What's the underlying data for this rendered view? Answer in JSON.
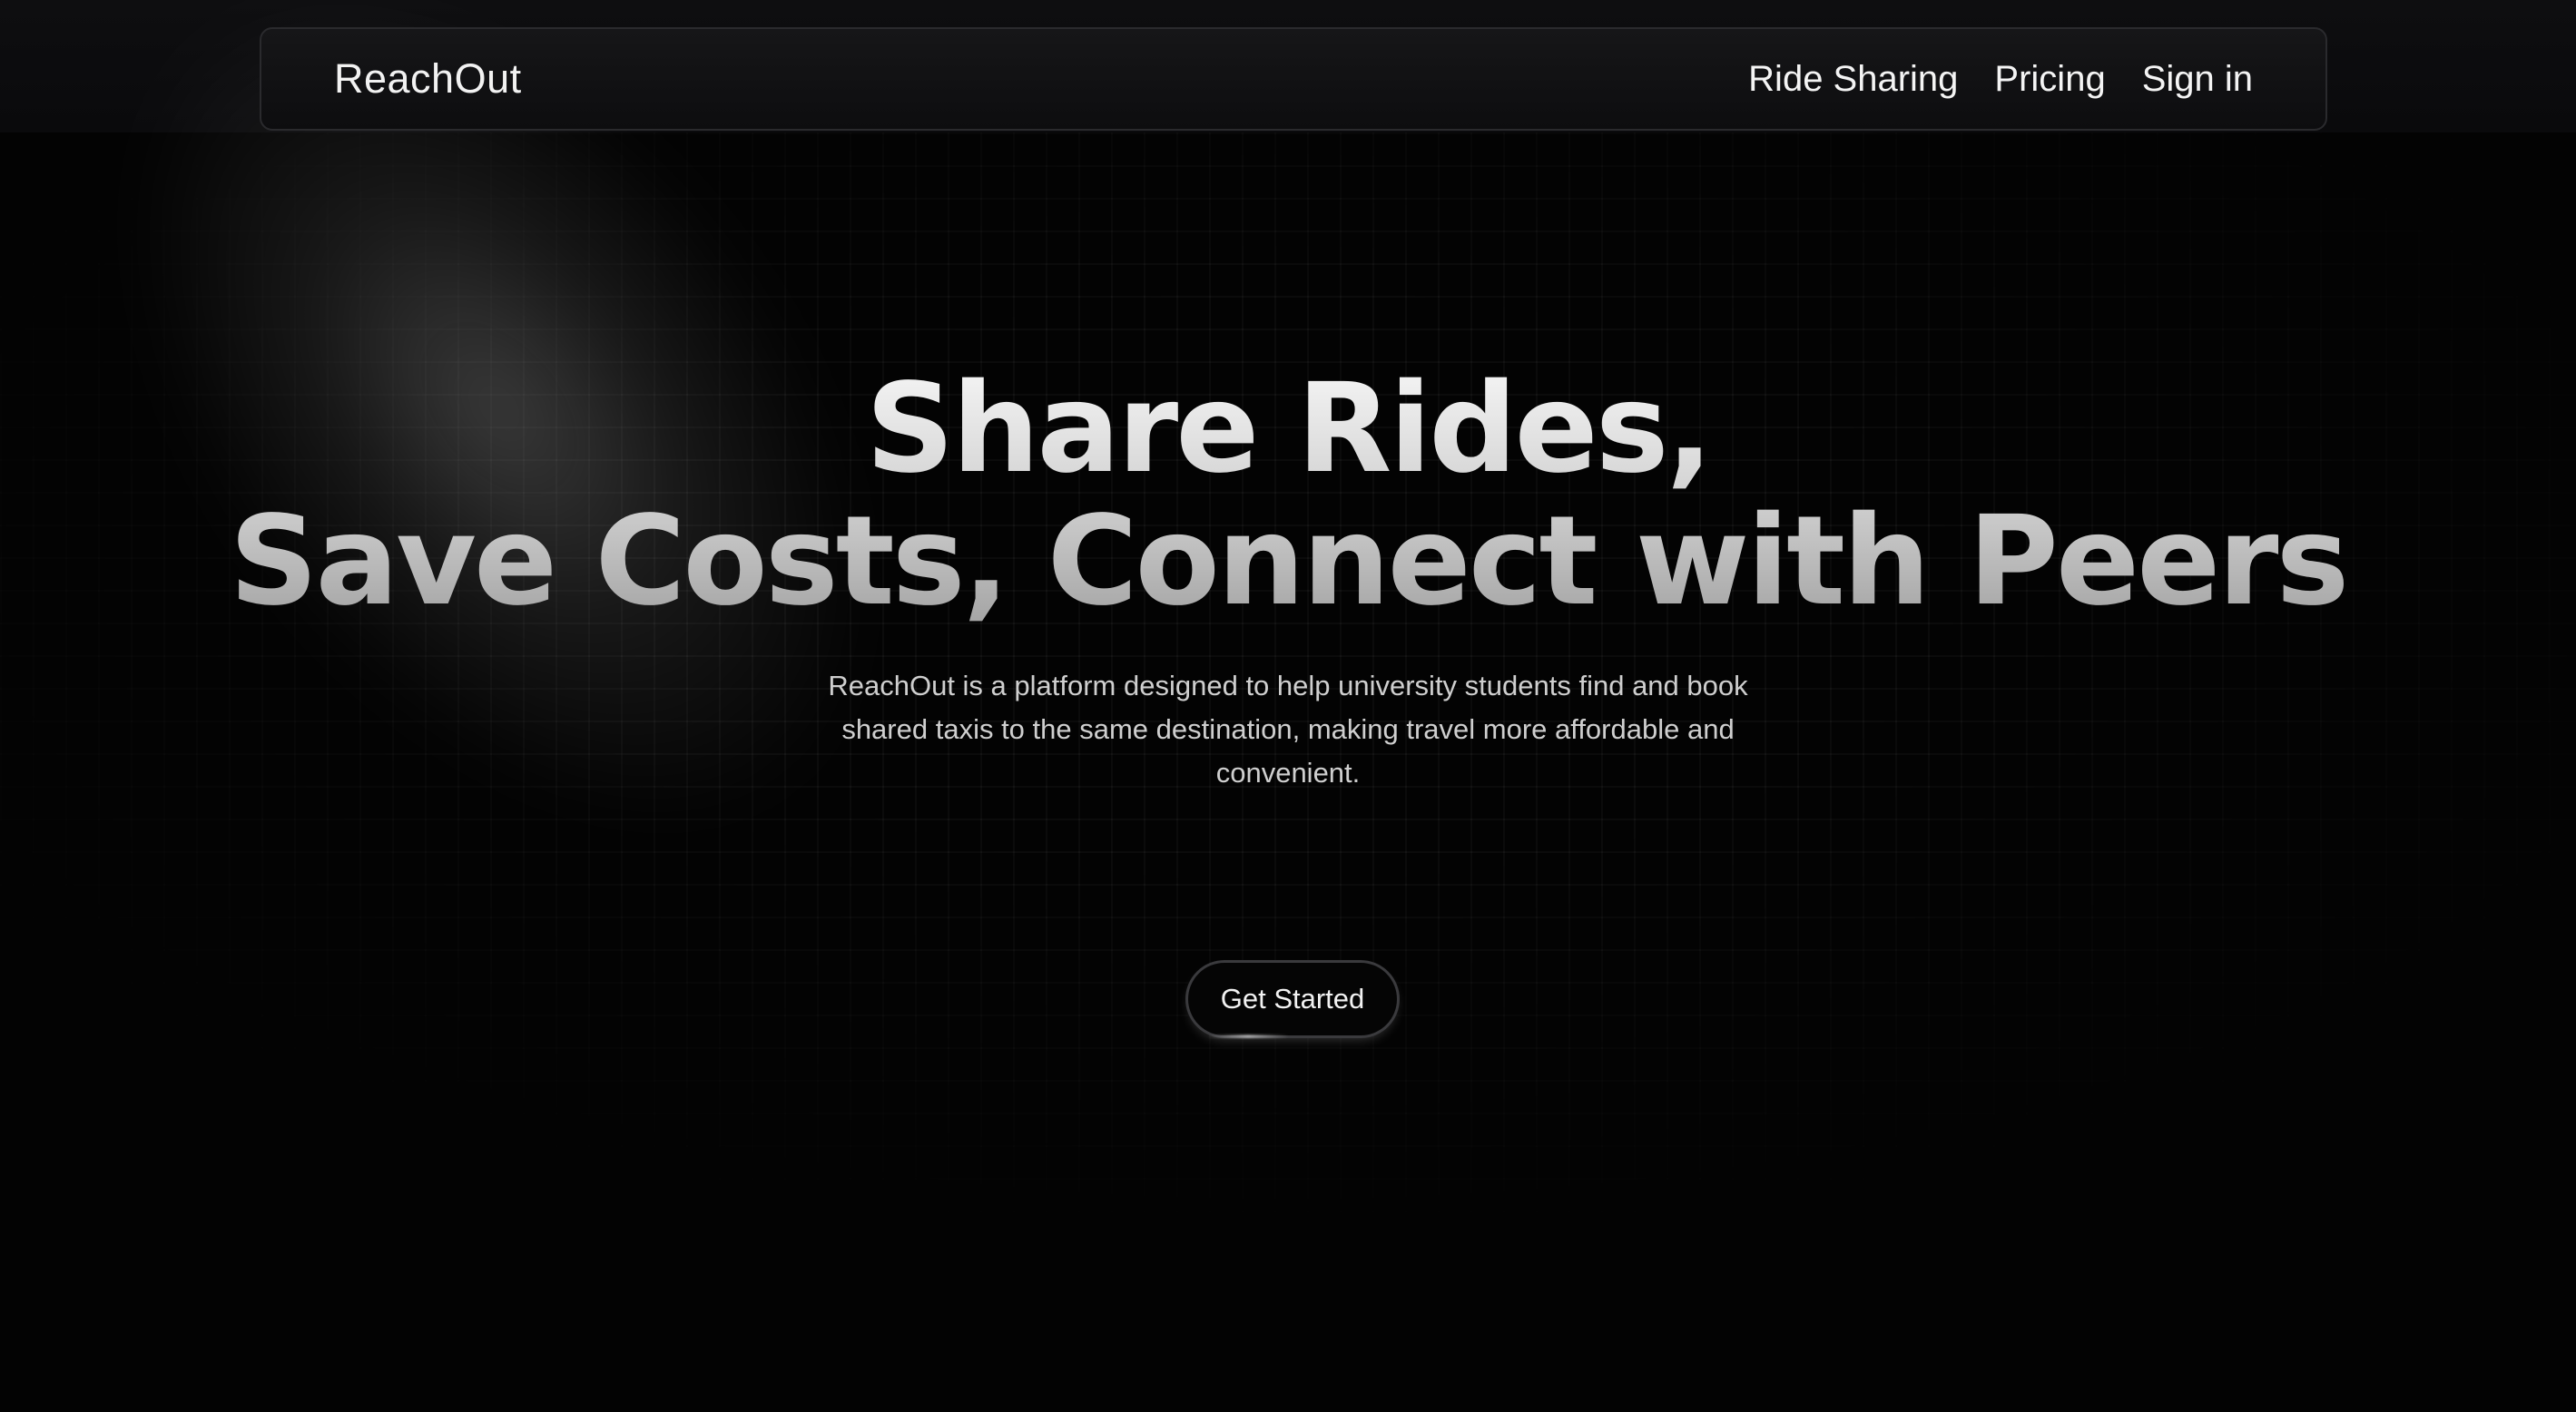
{
  "header": {
    "brand": "ReachOut",
    "nav": [
      {
        "label": "Ride Sharing"
      },
      {
        "label": "Pricing"
      },
      {
        "label": "Sign in"
      }
    ]
  },
  "hero": {
    "headline_line1": "Share Rides,",
    "headline_line2": "Save Costs, Connect with Peers",
    "subtitle": "ReachOut is a platform designed to help university students find and book shared taxis to the same destination, making travel more affordable and convenient.",
    "cta_label": "Get Started"
  },
  "colors": {
    "background": "#030303",
    "navbar_border": "#2a2a2d",
    "text_primary": "#f4f4f4",
    "text_muted": "#cfcfcf"
  }
}
